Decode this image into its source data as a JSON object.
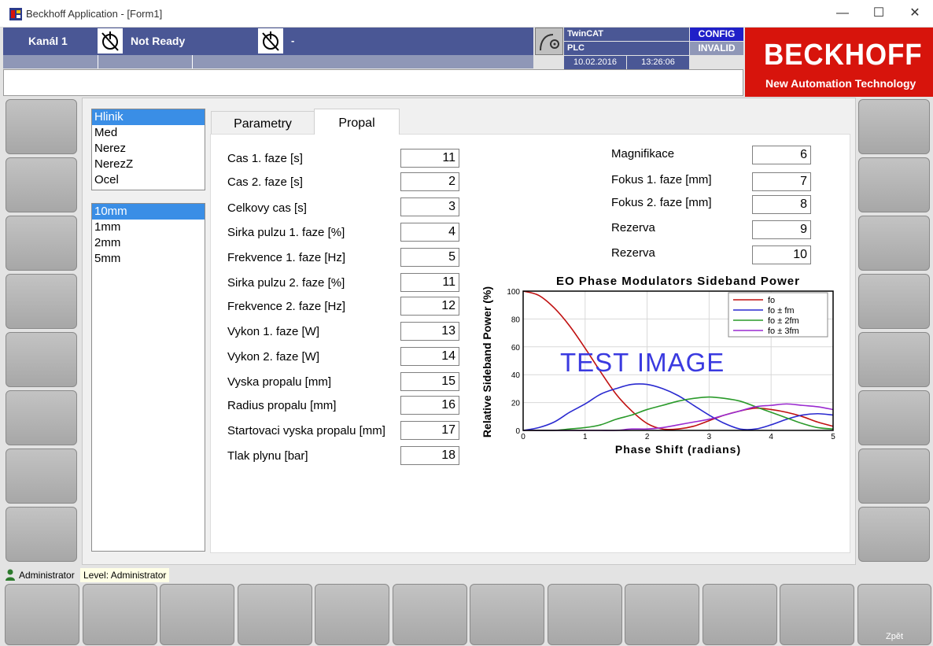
{
  "window": {
    "title": "Beckhoff Application - [Form1]",
    "controls": {
      "minimize": "—",
      "maximize": "☐",
      "close": "✕"
    }
  },
  "header": {
    "channel": "Kanál 1",
    "state_text": "Not Ready",
    "state2_text": "-",
    "twincat": "TwinCAT",
    "plc": "PLC",
    "date": "10.02.2016",
    "time": "13:26:06",
    "config": "CONFIG",
    "invalid": "INVALID"
  },
  "logo": {
    "name": "BECKHOFF",
    "tagline": "New Automation Technology"
  },
  "material_list": {
    "items": [
      "Hlinik",
      "Med",
      "Nerez",
      "NerezZ",
      "Ocel"
    ],
    "selected_index": 0
  },
  "thickness_list": {
    "items": [
      "10mm",
      "1mm",
      "2mm",
      "5mm"
    ],
    "selected_index": 0
  },
  "tabs": [
    {
      "label": "Parametry",
      "active": false
    },
    {
      "label": "Propal",
      "active": true
    }
  ],
  "params_left": [
    {
      "label": "Cas 1. faze [s]",
      "value": "11"
    },
    {
      "label": "Cas 2. faze [s]",
      "value": "2"
    },
    {
      "label": "Celkovy cas [s]",
      "value": "3"
    },
    {
      "label": "Sirka pulzu 1. faze [%]",
      "value": "4"
    },
    {
      "label": "Frekvence 1. faze [Hz]",
      "value": "5"
    },
    {
      "label": "Sirka pulzu 2. faze [%]",
      "value": "11"
    },
    {
      "label": "Frekvence 2. faze [Hz]",
      "value": "12"
    },
    {
      "label": "Vykon 1. faze [W]",
      "value": "13"
    },
    {
      "label": "Vykon 2. faze [W]",
      "value": "14"
    },
    {
      "label": "Vyska propalu [mm]",
      "value": "15"
    },
    {
      "label": "Radius propalu [mm]",
      "value": "16"
    },
    {
      "label": "Startovaci vyska propalu [mm]",
      "value": "17"
    },
    {
      "label": "Tlak plynu [bar]",
      "value": "18"
    }
  ],
  "params_right": [
    {
      "label": "Magnifikace",
      "value": "6"
    },
    {
      "label": "Fokus 1. faze [mm]",
      "value": "7"
    },
    {
      "label": "Fokus 2. faze [mm]",
      "value": "8"
    },
    {
      "label": "Rezerva",
      "value": "9"
    },
    {
      "label": "Rezerva",
      "value": "10"
    }
  ],
  "chart_data": {
    "type": "line",
    "title": "EO Phase Modulators Sideband Power",
    "xlabel": "Phase Shift (radians)",
    "ylabel": "Relative Sideband Power (%)",
    "xlim": [
      0,
      5
    ],
    "ylim": [
      0,
      100
    ],
    "xticks": [
      "0",
      "1",
      "2",
      "3",
      "4",
      "5"
    ],
    "yticks": [
      "0",
      "20",
      "40",
      "60",
      "80",
      "100"
    ],
    "grid": true,
    "legend_position": "top-right",
    "overlay_text": "TEST IMAGE",
    "x": [
      0,
      0.25,
      0.5,
      0.75,
      1,
      1.25,
      1.5,
      1.75,
      2,
      2.25,
      2.5,
      2.75,
      3,
      3.25,
      3.5,
      3.75,
      4,
      4.25,
      4.5,
      4.75,
      5
    ],
    "series": [
      {
        "name": "fo",
        "color": "#c01010",
        "values": [
          100,
          97,
          88,
          75,
          59,
          42,
          26,
          14,
          5,
          1,
          1,
          3,
          7,
          11,
          14,
          16,
          15,
          13,
          10,
          6,
          3
        ]
      },
      {
        "name": "fo ± fm",
        "color": "#2a2ad0",
        "values": [
          0,
          2,
          6,
          13,
          19,
          26,
          30,
          33,
          33,
          30,
          25,
          18,
          11,
          5,
          1,
          1,
          4,
          8,
          11,
          12,
          11
        ]
      },
      {
        "name": "fo ± 2fm",
        "color": "#2a9a2a",
        "values": [
          0,
          0,
          0,
          1,
          2,
          4,
          8,
          11,
          15,
          18,
          21,
          23,
          24,
          23,
          21,
          17,
          13,
          9,
          5,
          2,
          1
        ]
      },
      {
        "name": "fo ± 3fm",
        "color": "#9a2ad0",
        "values": [
          0,
          0,
          0,
          0,
          0,
          0,
          0,
          1,
          1,
          2,
          4,
          6,
          8,
          11,
          14,
          17,
          18,
          19,
          18,
          17,
          15
        ]
      }
    ]
  },
  "footer": {
    "user": "Administrator",
    "level": "Level: Administrator",
    "back_label": "Zpět"
  }
}
